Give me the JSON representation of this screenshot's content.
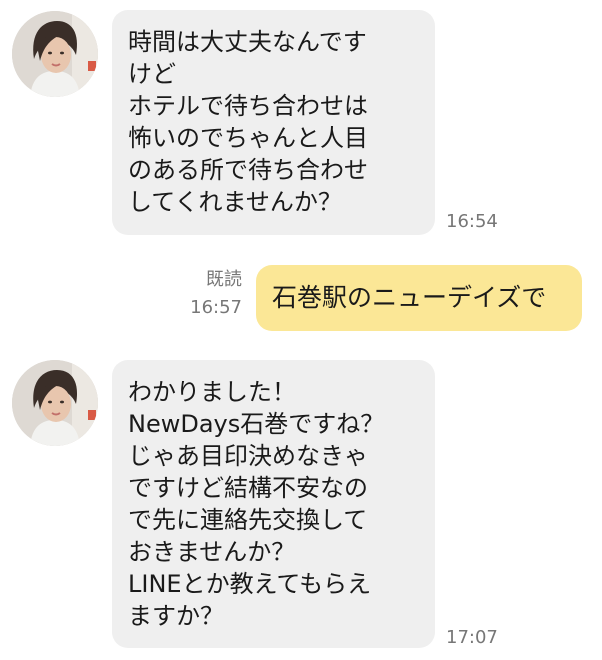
{
  "messages": [
    {
      "direction": "incoming",
      "lines": [
        "時間は大丈夫なんです",
        "けど",
        "ホテルで待ち合わせは",
        "怖いのでちゃんと人目",
        "のある所で待ち合わせ",
        "してくれませんか？"
      ],
      "time": "16:54"
    },
    {
      "direction": "outgoing",
      "text": "石巻駅のニューデイズで",
      "read_status": "既読",
      "time": "16:57"
    },
    {
      "direction": "incoming",
      "lines": [
        "わかりました！",
        "NewDays石巻ですね？",
        "じゃあ目印決めなきゃ",
        "ですけど結構不安なの",
        "で先に連絡先交換して",
        "おきませんか？",
        "LINEとか教えてもらえ",
        "ますか？"
      ],
      "time": "17:07"
    }
  ],
  "colors": {
    "incoming_bubble": "#efefef",
    "outgoing_bubble": "#fbe796",
    "timestamp": "#777777",
    "text": "#1a1a1a"
  }
}
